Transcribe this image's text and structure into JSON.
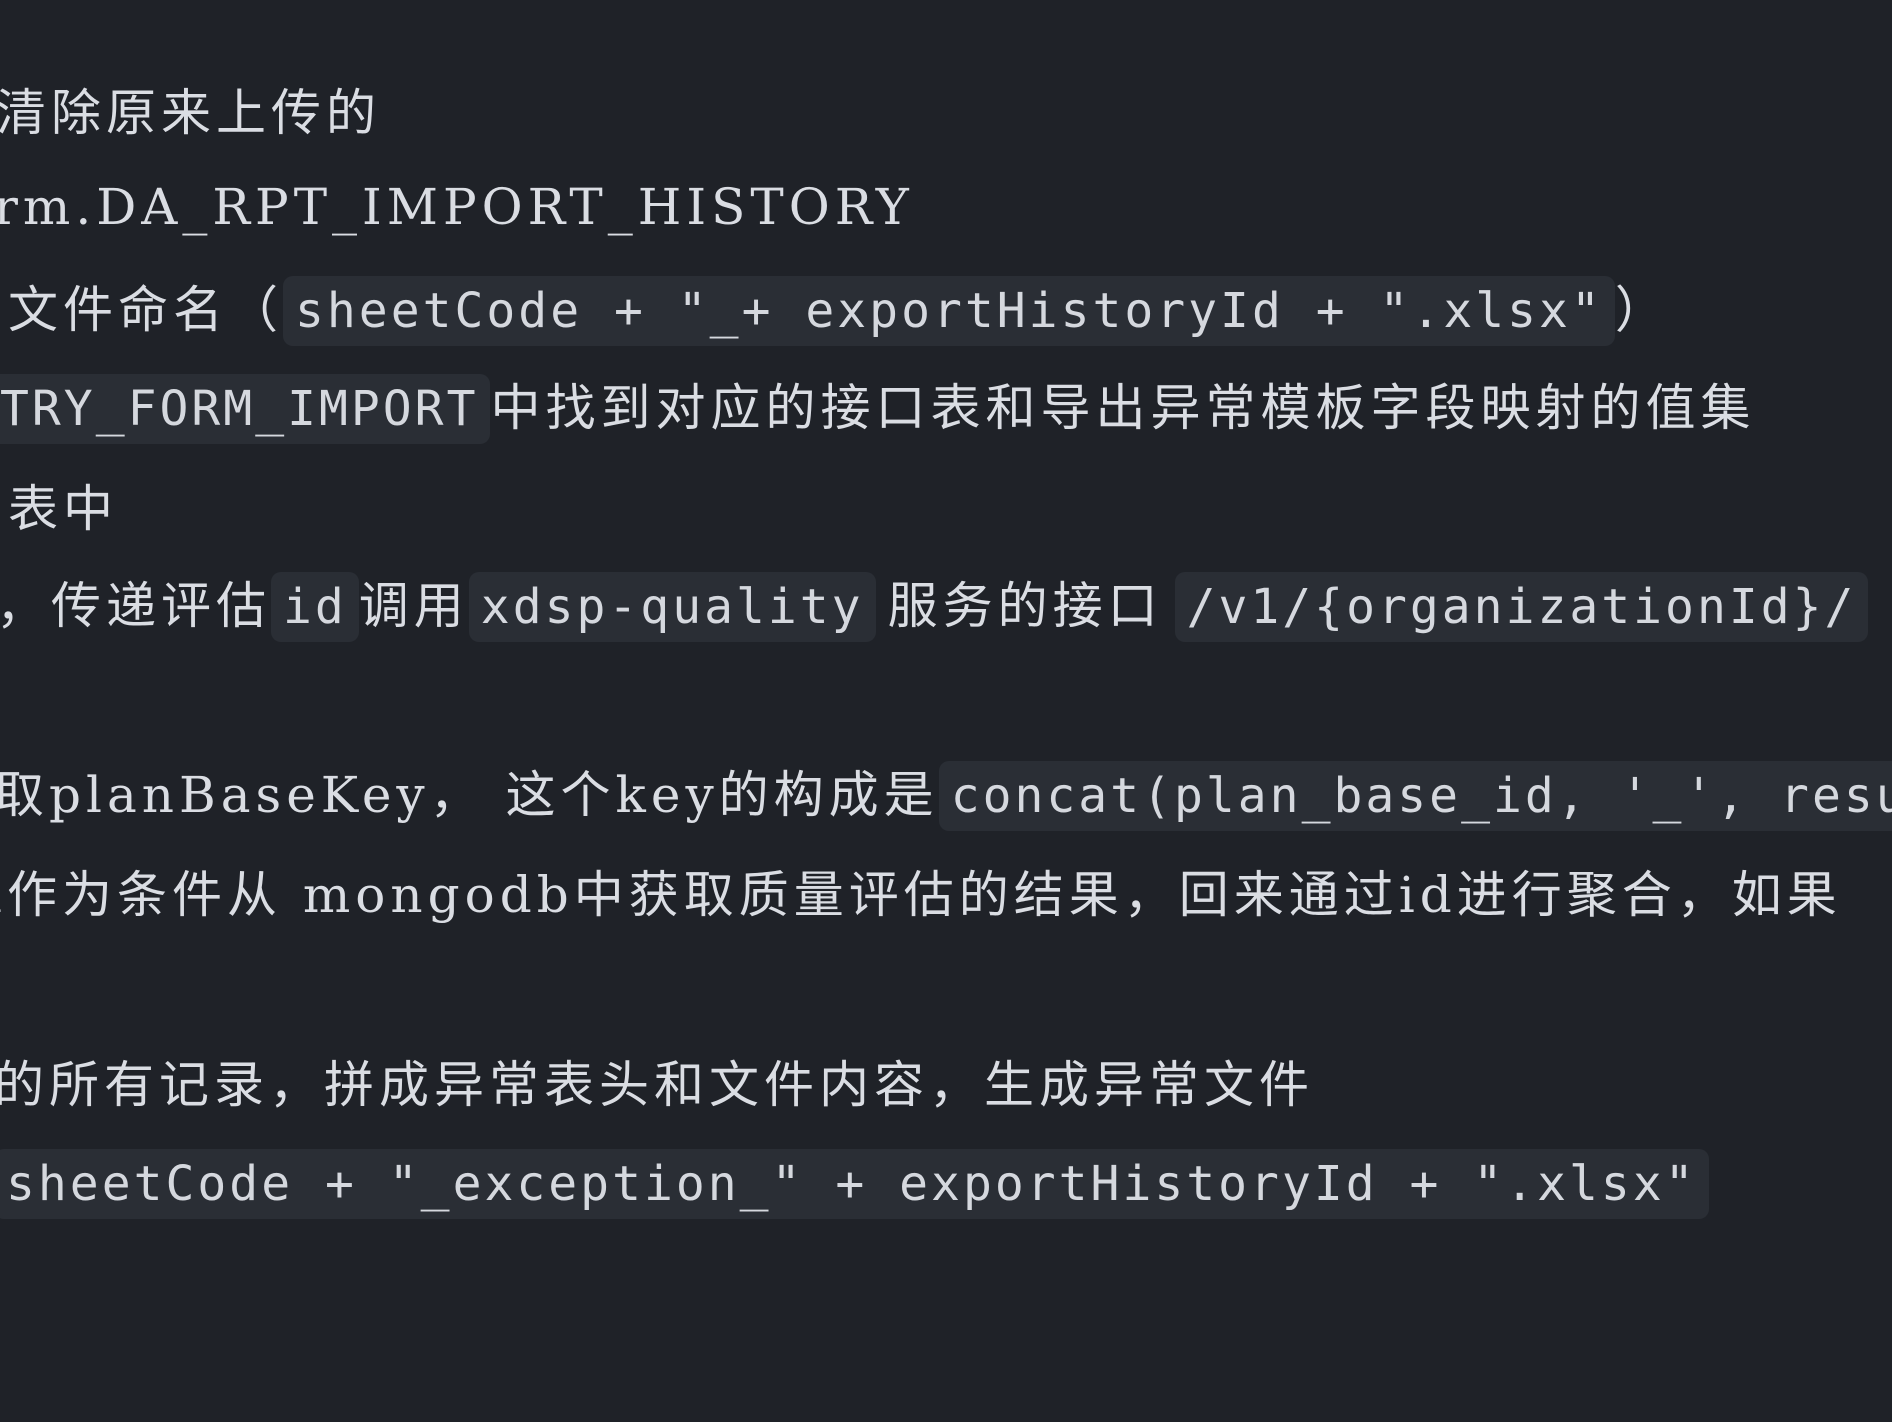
{
  "lines": {
    "l1": {
      "t1": "清除原来上传的"
    },
    "l2": {
      "t1": "rm.DA_RPT_IMPORT_HISTORY"
    },
    "l3": {
      "t1": "文件命名（",
      "c1": "sheetCode +  \"_+ exportHistoryId + \".xlsx\"",
      "t2": "）"
    },
    "l4": {
      "c1": "TRY_FORM_IMPORT",
      "t1": "中找到对应的接口表和导出异常模板字段映射的值集"
    },
    "l5": {
      "t1": "表中"
    },
    "l6": {
      "t1": "，传递评估",
      "c1": "id",
      "t2": "调用",
      "c2": "xdsp-quality",
      "t3": "服务的接口",
      "c3": "/v1/{organizationId}/"
    },
    "l7": {
      "t1": "取planBaseKey， 这个key的构成是",
      "c1": "concat(plan_base_id, '_', result"
    },
    "l8": {
      "t1": "l作为条件从 mongodb中获取质量评估的结果，回来通过id进行聚合，如果"
    },
    "l9": {
      "t1": "的所有记录，拼成异常表头和文件内容，生成异常文件"
    },
    "l10": {
      "c1": "sheetCode +  \"_exception_\" + exportHistoryId + \".xlsx\""
    }
  }
}
